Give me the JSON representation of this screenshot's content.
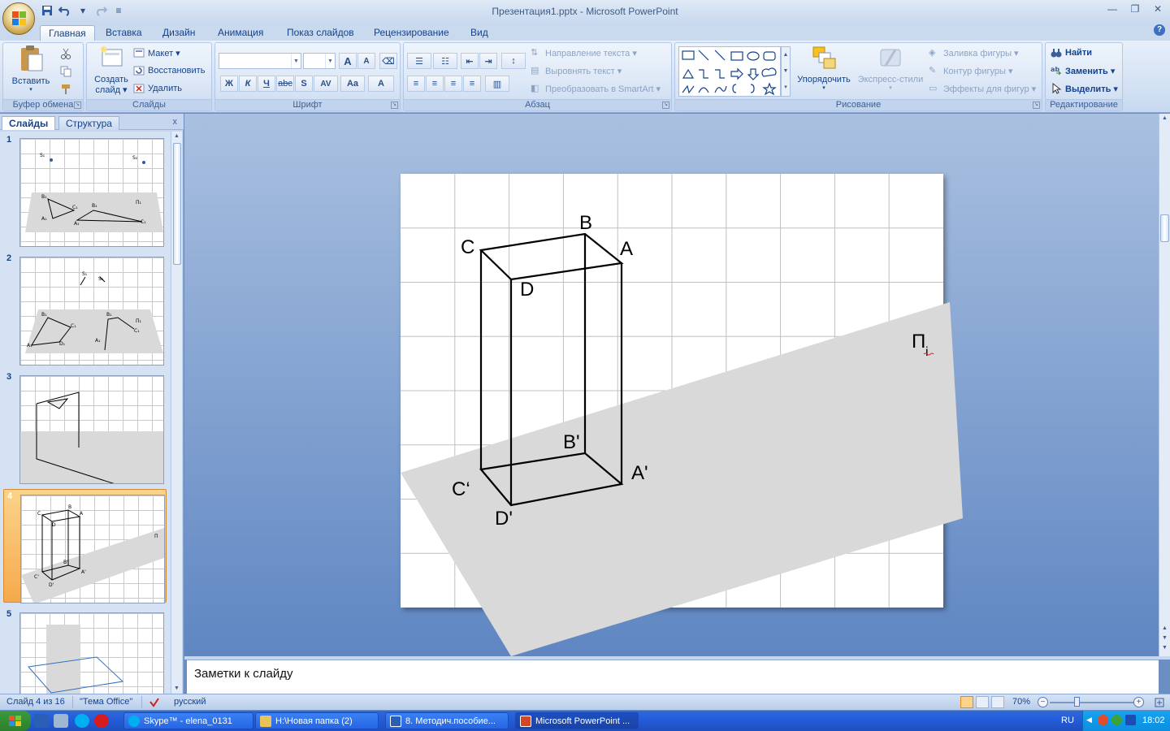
{
  "window": {
    "title": "Презентация1.pptx - Microsoft PowerPoint",
    "controls": [
      "—",
      "❐",
      "✕"
    ]
  },
  "tabs": [
    {
      "label": "Главная",
      "active": true
    },
    {
      "label": "Вставка"
    },
    {
      "label": "Дизайн"
    },
    {
      "label": "Анимация"
    },
    {
      "label": "Показ слайдов"
    },
    {
      "label": "Рецензирование"
    },
    {
      "label": "Вид"
    }
  ],
  "ribbon": {
    "clipboard": {
      "label": "Буфер обмена",
      "paste": "Вставить"
    },
    "slides": {
      "label": "Слайды",
      "new_slide_1": "Создать",
      "new_slide_2": "слайд ▾",
      "layout": "Макет ▾",
      "reset": "Восстановить",
      "delete": "Удалить"
    },
    "font": {
      "label": "Шрифт",
      "bold": "Ж",
      "italic": "К",
      "underline": "Ч",
      "strike": "abc",
      "shadow": "S",
      "spacing": "AV",
      "case": "Aa",
      "color": "A",
      "grow": "A",
      "shrink": "A"
    },
    "paragraph": {
      "label": "Абзац",
      "text_direction": "Направление текста ▾",
      "align_text": "Выровнять текст ▾",
      "smartart": "Преобразовать в SmartArt ▾"
    },
    "drawing": {
      "label": "Рисование",
      "arrange": "Упорядочить",
      "quick_styles": "Экспресс-стили",
      "fill": "Заливка фигуры ▾",
      "outline": "Контур фигуры ▾",
      "effects": "Эффекты для фигур ▾"
    },
    "editing": {
      "label": "Редактирование",
      "find": "Найти",
      "replace": "Заменить ▾",
      "select": "Выделить ▾"
    }
  },
  "left_pane": {
    "tab_slides": "Слайды",
    "tab_outline": "Структура",
    "close": "x",
    "thumbnails": [
      {
        "num": "1"
      },
      {
        "num": "2"
      },
      {
        "num": "3"
      },
      {
        "num": "4",
        "selected": true
      },
      {
        "num": "5"
      }
    ],
    "thumb1_labels": {
      "s1": "S₁",
      "s2": "S₂",
      "b1": "B₁",
      "c1": "C₁",
      "a1": "A₁",
      "b1b": "B₁",
      "a1b": "A₁",
      "c1b": "C₁",
      "pi": "Π₁"
    },
    "thumb2_labels": {
      "s1": "S₁",
      "s2": "S₂",
      "b1": "B₁",
      "c1": "C₁",
      "a1": "A₁",
      "d1": "D₁",
      "b1b": "B₁",
      "pi": "Π₁",
      "c1b": "C₁",
      "a1b": "A₁"
    },
    "thumb4_labels": {
      "c": "C",
      "b": "B",
      "a": "A",
      "d": "D",
      "pi": "Π",
      "b2": "B'",
      "a2": "A'",
      "c2": "C'",
      "d2": "D'"
    }
  },
  "slide": {
    "labels": {
      "b": "B",
      "c": "C",
      "a": "A",
      "d": "D",
      "b_prime": "B'",
      "a_prime": "A'",
      "c_prime": "C‘",
      "d_prime": "D'",
      "plane": "Π",
      "plane_sub": "i"
    },
    "colors": {
      "plane": "#d9d9d9",
      "grid": "#c0c0c0",
      "edges": "#000000"
    }
  },
  "notes": {
    "placeholder": "Заметки к слайду"
  },
  "status": {
    "slide_counter": "Слайд 4 из 16",
    "theme": "\"Тема Office\"",
    "language": "русский",
    "zoom": "70%"
  },
  "taskbar": {
    "items": [
      {
        "label": "Skype™ - elena_0131",
        "color": "#00aff0"
      },
      {
        "label": "H:\\Новая папка (2)",
        "color": "#e7c35a"
      },
      {
        "label": "8. Методич.пособие...",
        "color": "#2b5fb5"
      },
      {
        "label": "Microsoft PowerPoint ...",
        "color": "#d24726",
        "active": true
      }
    ],
    "lang": "RU",
    "time": "18:02"
  }
}
